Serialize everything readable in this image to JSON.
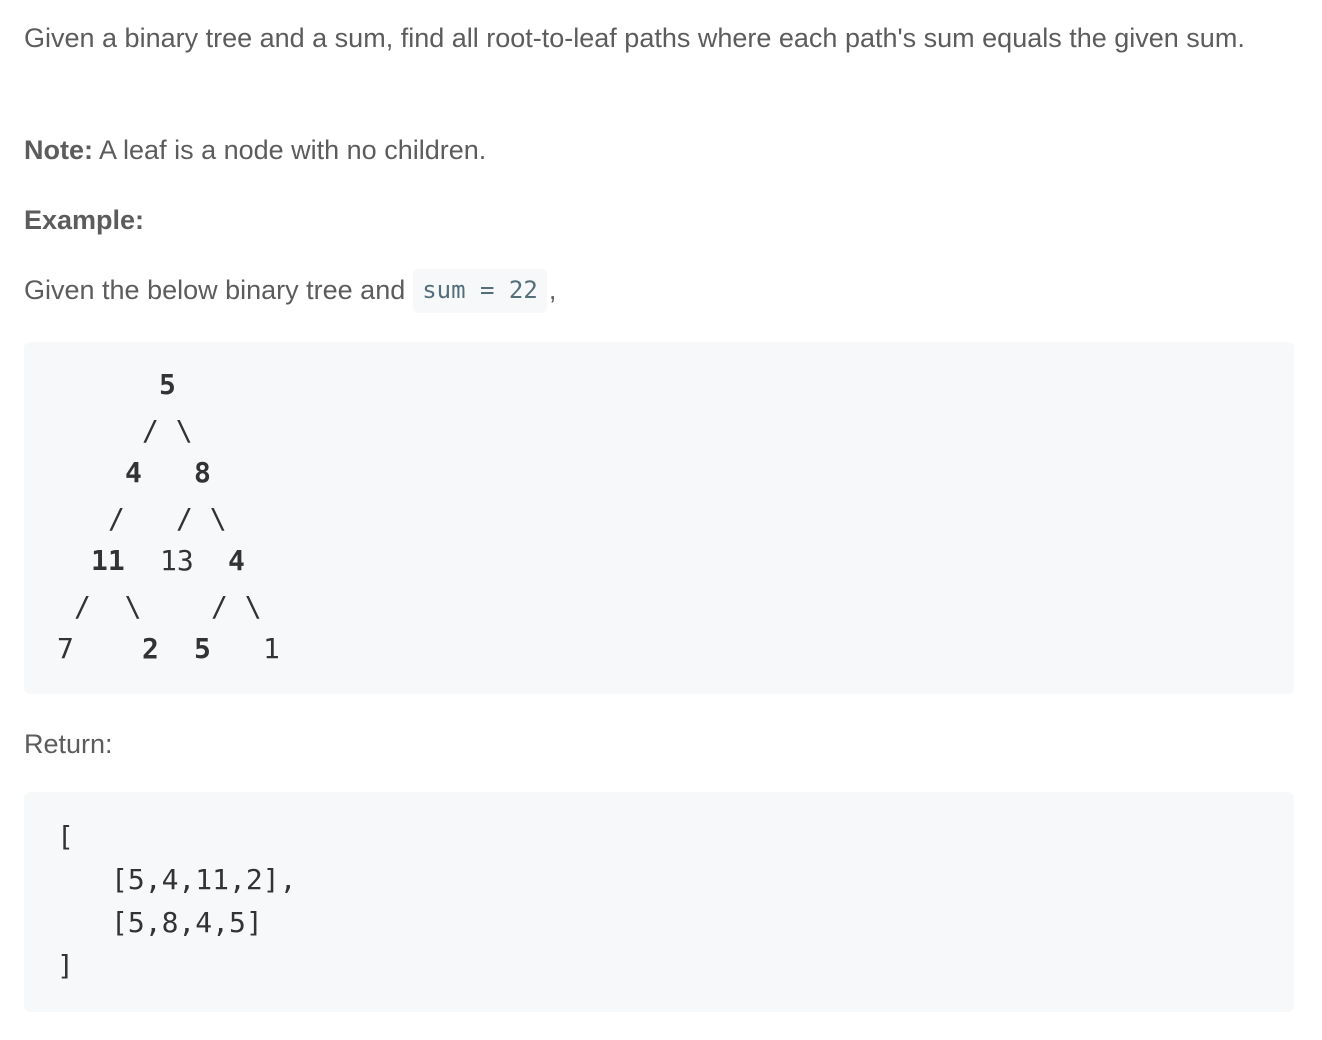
{
  "intro": "Given a binary tree and a sum, find all root-to-leaf paths where each path's sum equals the given sum.",
  "note": {
    "label": "Note:",
    "text": " A leaf is a node with no children."
  },
  "example_label": "Example:",
  "given": {
    "text": "Given the below binary tree and",
    "code": "sum = 22",
    "suffix": ","
  },
  "tree": {
    "root": "5",
    "edges_l1": "/ \\",
    "node_4": "4",
    "node_8": "8",
    "edge_l2_left": "/",
    "edges_l2_right": "/ \\",
    "node_11": "11",
    "node_13": "13",
    "node_4b": "4",
    "edges_l3_left": "/  \\",
    "edges_l3_right": "/ \\",
    "node_7": "7",
    "node_2": "2",
    "node_5": "5",
    "node_1": "1"
  },
  "return_label": "Return:",
  "result": {
    "open": "[",
    "line1": "[5,4,11,2],",
    "line2": "[5,8,4,5]",
    "close": "]"
  }
}
